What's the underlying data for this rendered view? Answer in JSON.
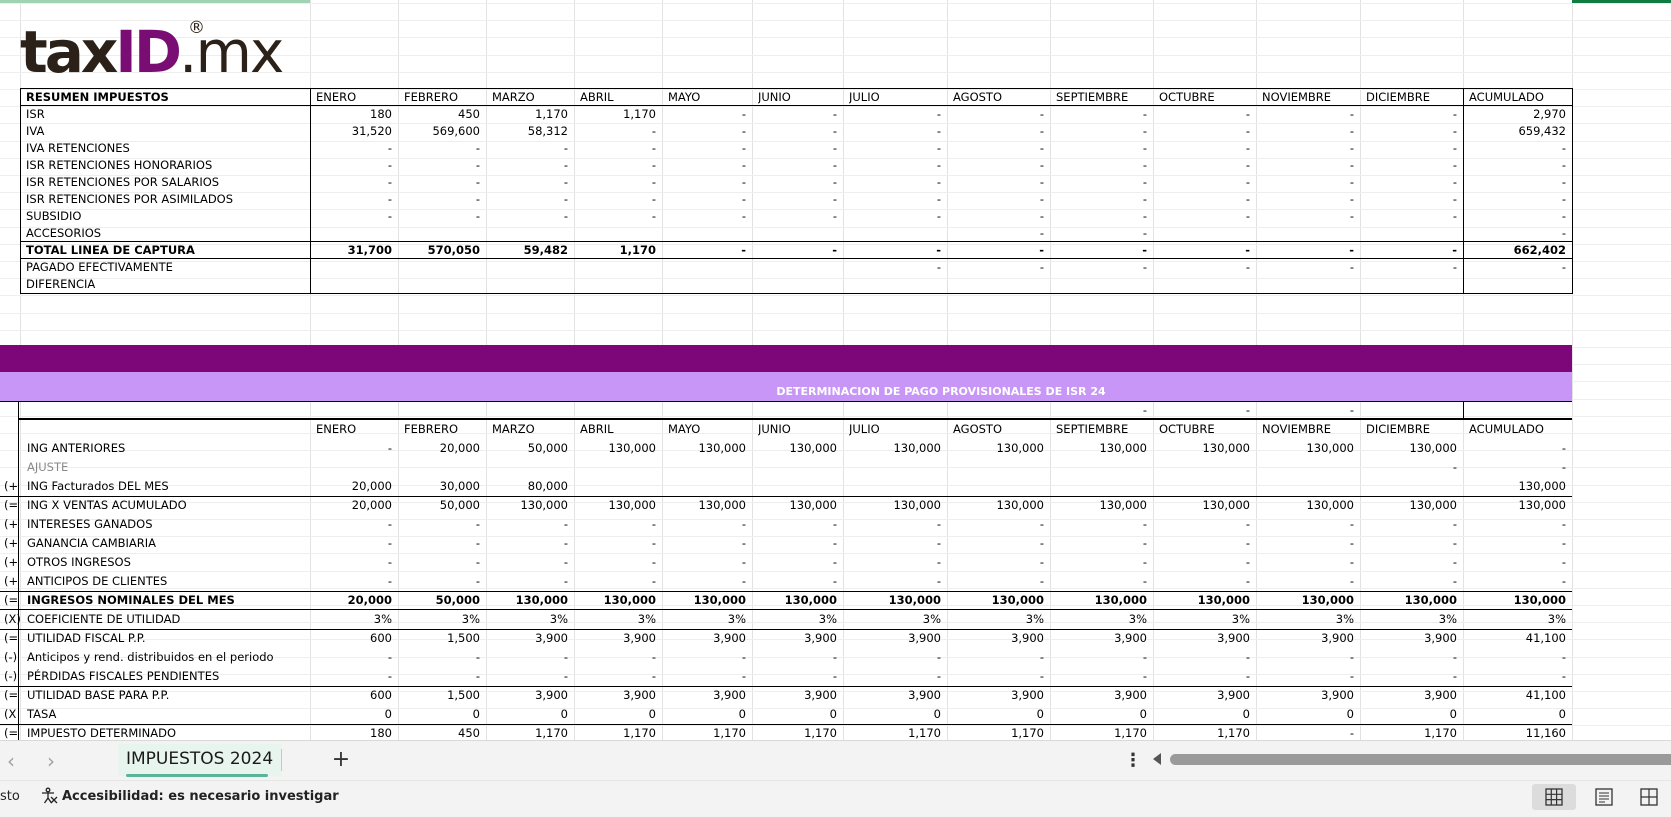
{
  "logo": {
    "tax": "tax",
    "id": "ID",
    "mx": ".mx",
    "reg": "®"
  },
  "months": [
    "ENERO",
    "FEBRERO",
    "MARZO",
    "ABRIL",
    "MAYO",
    "JUNIO",
    "JULIO",
    "AGOSTO",
    "SEPTIEMBRE",
    "OCTUBRE",
    "NOVIEMBRE",
    "DICIEMBRE",
    "ACUMULADO"
  ],
  "resumen": {
    "header": "RESUMEN IMPUESTOS",
    "rows": [
      {
        "label": "ISR",
        "vals": [
          "180",
          "450",
          "1,170",
          "1,170",
          "-",
          "-",
          "-",
          "-",
          "-",
          "-",
          "-",
          "-",
          "2,970"
        ]
      },
      {
        "label": "IVA",
        "vals": [
          "31,520",
          "569,600",
          "58,312",
          "-",
          "-",
          "-",
          "-",
          "-",
          "-",
          "-",
          "-",
          "-",
          "659,432"
        ]
      },
      {
        "label": "IVA RETENCIONES",
        "vals": [
          "-",
          "-",
          "-",
          "-",
          "-",
          "-",
          "-",
          "-",
          "-",
          "-",
          "-",
          "-",
          "-"
        ]
      },
      {
        "label": "ISR RETENCIONES HONORARIOS",
        "vals": [
          "-",
          "-",
          "-",
          "-",
          "-",
          "-",
          "-",
          "-",
          "-",
          "-",
          "-",
          "-",
          "-"
        ]
      },
      {
        "label": "ISR RETENCIONES POR SALARIOS",
        "vals": [
          "-",
          "-",
          "-",
          "-",
          "-",
          "-",
          "-",
          "-",
          "-",
          "-",
          "-",
          "-",
          "-"
        ]
      },
      {
        "label": "ISR RETENCIONES POR ASIMILADOS",
        "vals": [
          "-",
          "-",
          "-",
          "-",
          "-",
          "-",
          "-",
          "-",
          "-",
          "-",
          "-",
          "-",
          "-"
        ]
      },
      {
        "label": "SUBSIDIO",
        "vals": [
          "-",
          "-",
          "-",
          "-",
          "-",
          "-",
          "-",
          "-",
          "-",
          "-",
          "-",
          "-",
          "-"
        ]
      },
      {
        "label": "ACCESORIOS",
        "vals": [
          "",
          "",
          "",
          "",
          "",
          "",
          "",
          "-",
          "-",
          "",
          "",
          "",
          "-"
        ]
      },
      {
        "label": "TOTAL LINEA DE CAPTURA",
        "bold": true,
        "vals": [
          "31,700",
          "570,050",
          "59,482",
          "1,170",
          "-",
          "-",
          "-",
          "-",
          "-",
          "-",
          "-",
          "-",
          "662,402"
        ]
      },
      {
        "label": "PAGADO EFECTIVAMENTE",
        "vals": [
          "",
          "",
          "",
          "",
          "",
          "",
          "-",
          "-",
          "-",
          "-",
          "-",
          "-",
          "-"
        ]
      },
      {
        "label": "DIFERENCIA",
        "vals": [
          "",
          "",
          "",
          "",
          "",
          "",
          "",
          "",
          "",
          "",
          "",
          "",
          ""
        ]
      }
    ]
  },
  "determinacion": {
    "title": "DETERMINACION DE PAGO PROVISIONALES DE ISR 24",
    "spacer_vals": [
      "",
      "",
      "",
      "",
      "",
      "",
      "",
      "",
      "-",
      "-",
      "-",
      "",
      ""
    ],
    "rows": [
      {
        "sign": "",
        "label": "ING ANTERIORES",
        "vals": [
          "-",
          "20,000",
          "50,000",
          "130,000",
          "130,000",
          "130,000",
          "130,000",
          "130,000",
          "130,000",
          "130,000",
          "130,000",
          "130,000",
          "-"
        ]
      },
      {
        "sign": "",
        "label": "AJUSTE",
        "gray": true,
        "vals": [
          "",
          "",
          "",
          "",
          "",
          "",
          "",
          "",
          "",
          "",
          "",
          "-",
          "-"
        ]
      },
      {
        "sign": "(+",
        "label": "ING Facturados  DEL MES",
        "vals": [
          "20,000",
          "30,000",
          "80,000",
          "",
          "",
          "",
          "",
          "",
          "",
          "",
          "",
          "",
          "130,000"
        ]
      },
      {
        "sign": "(=",
        "label": "ING X VENTAS ACUMULADO",
        "vals": [
          "20,000",
          "50,000",
          "130,000",
          "130,000",
          "130,000",
          "130,000",
          "130,000",
          "130,000",
          "130,000",
          "130,000",
          "130,000",
          "130,000",
          "130,000"
        ]
      },
      {
        "sign": "(+",
        "label": "INTERESES GANADOS",
        "vals": [
          "-",
          "-",
          "-",
          "-",
          "-",
          "-",
          "-",
          "-",
          "-",
          "-",
          "-",
          "-",
          "-"
        ]
      },
      {
        "sign": "(+",
        "label": "GANANCIA CAMBIARIA",
        "vals": [
          "-",
          "-",
          "-",
          "-",
          "-",
          "-",
          "-",
          "-",
          "-",
          "-",
          "-",
          "-",
          "-"
        ]
      },
      {
        "sign": "(+",
        "label": "OTROS INGRESOS",
        "vals": [
          "-",
          "-",
          "-",
          "-",
          "-",
          "-",
          "-",
          "-",
          "-",
          "-",
          "-",
          "-",
          "-"
        ]
      },
      {
        "sign": "(+",
        "label": "ANTICIPOS DE CLIENTES",
        "vals": [
          "-",
          "-",
          "-",
          "-",
          "-",
          "-",
          "-",
          "-",
          "-",
          "-",
          "-",
          "-",
          "-"
        ]
      },
      {
        "sign": "(=",
        "label": "INGRESOS NOMINALES DEL MES",
        "bold": true,
        "vals": [
          "20,000",
          "50,000",
          "130,000",
          "130,000",
          "130,000",
          "130,000",
          "130,000",
          "130,000",
          "130,000",
          "130,000",
          "130,000",
          "130,000",
          "130,000"
        ]
      },
      {
        "sign": "(X)",
        "label": "COEFICIENTE DE UTILIDAD",
        "vals": [
          "3%",
          "3%",
          "3%",
          "3%",
          "3%",
          "3%",
          "3%",
          "3%",
          "3%",
          "3%",
          "3%",
          "3%",
          "3%"
        ]
      },
      {
        "sign": "(=",
        "label": "UTILIDAD FISCAL P.P.",
        "vals": [
          "600",
          "1,500",
          "3,900",
          "3,900",
          "3,900",
          "3,900",
          "3,900",
          "3,900",
          "3,900",
          "3,900",
          "3,900",
          "3,900",
          "41,100"
        ]
      },
      {
        "sign": "(-)",
        "label": "Anticipos y rend. distribuidos en el periodo",
        "vals": [
          "-",
          "-",
          "-",
          "-",
          "-",
          "-",
          "-",
          "-",
          "-",
          "-",
          "-",
          "-",
          "-"
        ]
      },
      {
        "sign": "(-)",
        "label": "PÉRDIDAS FISCALES PENDIENTES",
        "vals": [
          "-",
          "-",
          "-",
          "-",
          "-",
          "-",
          "-",
          "-",
          "-",
          "-",
          "-",
          "-",
          "-"
        ]
      },
      {
        "sign": "(=",
        "label": "UTILIDAD BASE PARA P.P.",
        "vals": [
          "600",
          "1,500",
          "3,900",
          "3,900",
          "3,900",
          "3,900",
          "3,900",
          "3,900",
          "3,900",
          "3,900",
          "3,900",
          "3,900",
          "41,100"
        ]
      },
      {
        "sign": "(X",
        "label": "TASA",
        "vals": [
          "0",
          "0",
          "0",
          "0",
          "0",
          "0",
          "0",
          "0",
          "0",
          "0",
          "0",
          "0",
          "0"
        ]
      },
      {
        "sign": "(=",
        "label": "IMPUESTO DETERMINADO",
        "vals": [
          "180",
          "450",
          "1,170",
          "1,170",
          "1,170",
          "1,170",
          "1,170",
          "1,170",
          "1,170",
          "1,170",
          "-",
          "1,170",
          "11,160"
        ]
      }
    ]
  },
  "tabbar": {
    "prev_icon": "chevron-left-icon",
    "next_icon": "chevron-right-icon",
    "sheet_name": "IMPUESTOS 2024",
    "add_label": "+",
    "more_label": "⋮"
  },
  "statusbar": {
    "left_fragment": "sto",
    "accessibility": "Accesibilidad: es necesario investigar"
  },
  "colors": {
    "band_dark": "#7d0779",
    "band_light": "#c896f6",
    "logo_id": "#7a0d74",
    "tab_accent": "#58b59a"
  }
}
